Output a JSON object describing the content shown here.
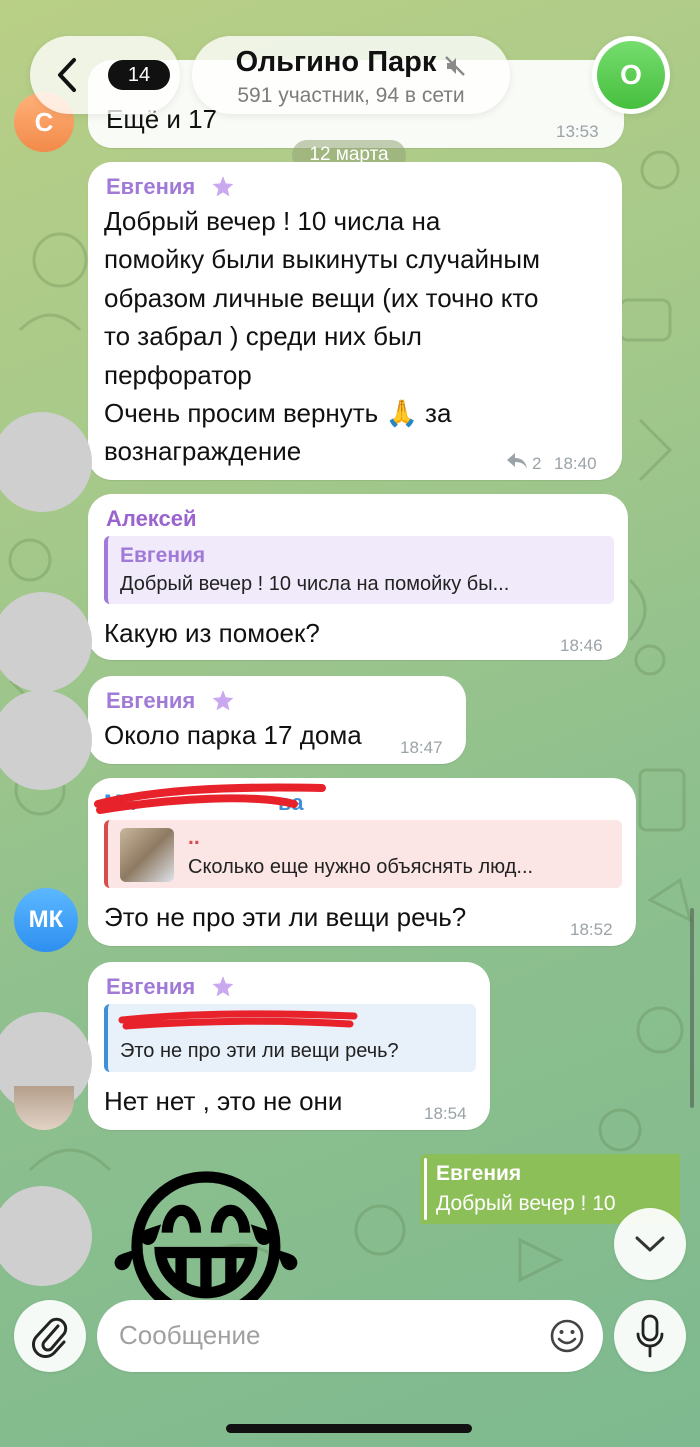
{
  "header": {
    "back_count": "14",
    "title": "Ольгино Парк",
    "subtitle": "591 участник, 94 в сети",
    "avatar_letter": "О"
  },
  "top_partial": {
    "avatar_letter": "С",
    "text": "Ещё и 17",
    "time": "13:53"
  },
  "date_separator": "12 марта",
  "messages": [
    {
      "sender": "Евгения",
      "text": "Добрый вечер ! 10 числа на\nпомойку были выкинуты случайным\nобразом личные вещи (их точно кто\nто  забрал ) среди них был\nперфоратор\nОчень просим вернуть 🙏 за\nвознаграждение",
      "replies": "2",
      "time": "18:40"
    },
    {
      "sender": "Алексей",
      "quote_name": "Евгения",
      "quote_text": "Добрый вечер ! 10 числа на помойку бы...",
      "text": "Какую из помоек?",
      "time": "18:46"
    },
    {
      "sender": "Евгения",
      "text": "Около парка 17 дома",
      "time": "18:47"
    },
    {
      "sender": "Ма",
      "sender_end": "ва",
      "avatar": "МК",
      "quote_name": "..",
      "quote_text": "Сколько еще нужно объяснять люд...",
      "text": "Это не про эти ли вещи речь?",
      "time": "18:52"
    },
    {
      "sender": "Евгения",
      "quote_text": "Это не про эти ли вещи речь?",
      "text": "Нет нет , это не они",
      "time": "18:54"
    }
  ],
  "outgoing_reply": {
    "quote_name": "Евгения",
    "quote_text": "Добрый вечер ! 10"
  },
  "sticker": "😂",
  "input": {
    "placeholder": "Сообщение"
  },
  "colors": {
    "evgenia": "#a07ad6",
    "alexey": "#9a63d0",
    "mk": "#3d8fd8",
    "outgoing_quote_bg": "#8dbf58",
    "redaction": "#e8222a"
  },
  "icons": [
    "back-chevron-icon",
    "mute-icon",
    "star-icon",
    "reply-icon",
    "paperclip-icon",
    "sticker-icon",
    "microphone-icon",
    "chevron-down-icon"
  ]
}
